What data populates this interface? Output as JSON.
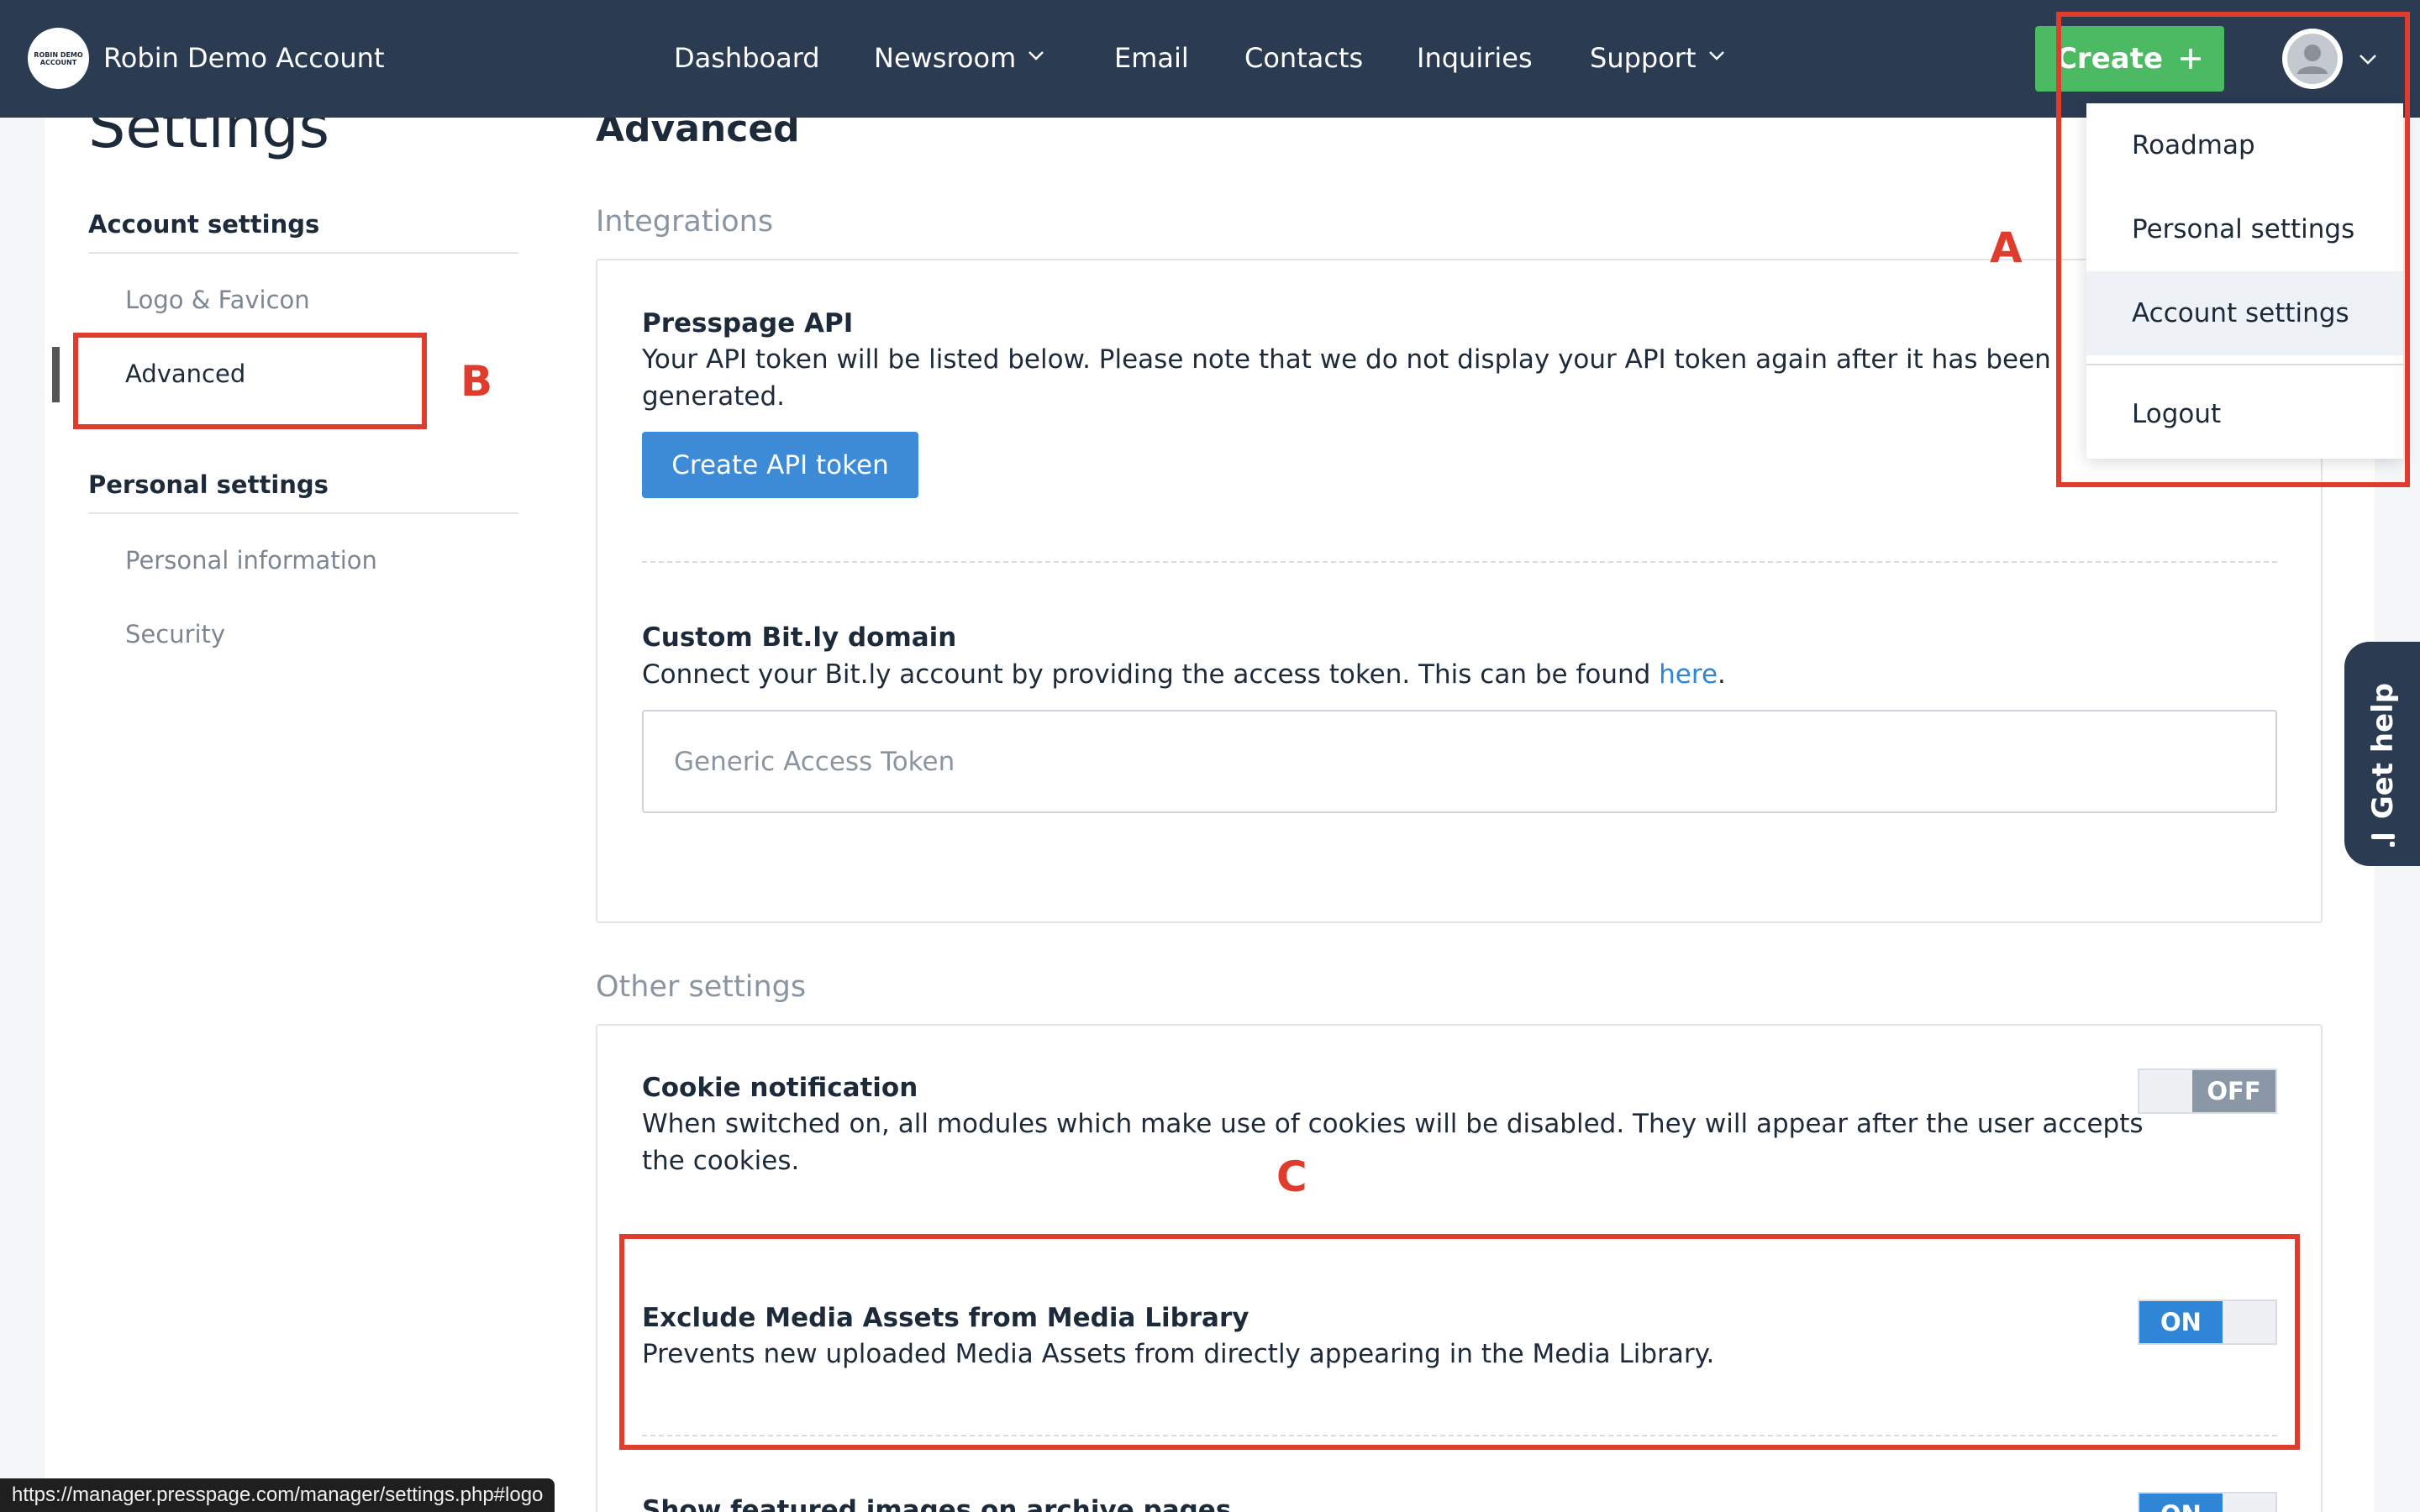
{
  "header": {
    "logo_text": "ROBIN DEMO ACCOUNT",
    "account_name": "Robin Demo Account",
    "nav": [
      {
        "label": "Dashboard"
      },
      {
        "label": "Newsroom"
      },
      {
        "label": "Email"
      },
      {
        "label": "Contacts"
      },
      {
        "label": "Inquiries"
      },
      {
        "label": "Support"
      }
    ],
    "create_label": "Create",
    "icons": {
      "create": "plus-icon",
      "avatar": "user-avatar-icon",
      "menu": "chevron-down-icon"
    },
    "colors": {
      "bar": "#2a3b52",
      "create": "#4cb963"
    }
  },
  "user_menu": {
    "items": [
      {
        "label": "Roadmap"
      },
      {
        "label": "Personal settings"
      },
      {
        "label": "Account settings",
        "highlighted": true
      },
      {
        "label": "Logout"
      }
    ]
  },
  "sidebar": {
    "title": "Settings",
    "account_heading": "Account settings",
    "account_items": [
      {
        "label": "Logo & Favicon"
      },
      {
        "label": "Advanced",
        "active": true
      }
    ],
    "personal_heading": "Personal settings",
    "personal_items": [
      {
        "label": "Personal information"
      },
      {
        "label": "Security"
      }
    ]
  },
  "main": {
    "title": "Advanced",
    "integrations_label": "Integrations",
    "api": {
      "title": "Presspage API",
      "description_1": "Your API token will be listed below. Please note that we do not display your API token again after it has been",
      "description_2": "generated.",
      "button_label": "Create API token"
    },
    "bitly": {
      "title": "Custom Bit.ly domain",
      "description": "Connect your Bit.ly account by providing the access token. This can be found ",
      "link_text": "here",
      "period": ".",
      "input_placeholder": "Generic Access Token",
      "input_value": ""
    },
    "other_label": "Other settings",
    "cookie": {
      "title": "Cookie notification",
      "description_1": "When switched on, all modules which make use of cookies will be disabled. They will appear after the user accepts",
      "description_2": "the cookies.",
      "toggle": "OFF"
    },
    "media": {
      "title": "Exclude Media Assets from Media Library",
      "description": "Prevents new uploaded Media Assets from directly appearing in the Media Library.",
      "toggle": "ON"
    },
    "featured": {
      "title": "Show featured images on archive pages",
      "toggle": "ON"
    },
    "colors": {
      "primary_button": "#3d8ad6",
      "toggle_on": "#2f86d6",
      "toggle_off": "#8a97a6"
    }
  },
  "annotations": {
    "a": "A",
    "b": "B",
    "c": "C",
    "color": "#e03c2d"
  },
  "help_tab": {
    "label": "Get help",
    "icon": "info-icon"
  },
  "status_bar": {
    "url": "https://manager.presspage.com/manager/settings.php#logo"
  }
}
